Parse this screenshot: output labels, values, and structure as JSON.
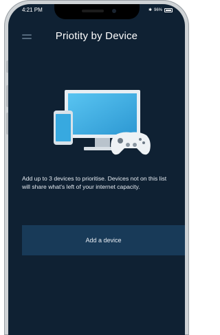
{
  "status_bar": {
    "time": "4:21 PM",
    "bluetooth": "✱",
    "battery": "96%"
  },
  "header": {
    "title": "Priotity by Device"
  },
  "content": {
    "description": "Add up to 3 devices to prioritise. Devices not on this list will share what's left of your internet capacity.",
    "add_button_label": "Add a device"
  },
  "colors": {
    "background": "#0f2133",
    "button": "#183a58",
    "accent": "#3fb4ea"
  }
}
